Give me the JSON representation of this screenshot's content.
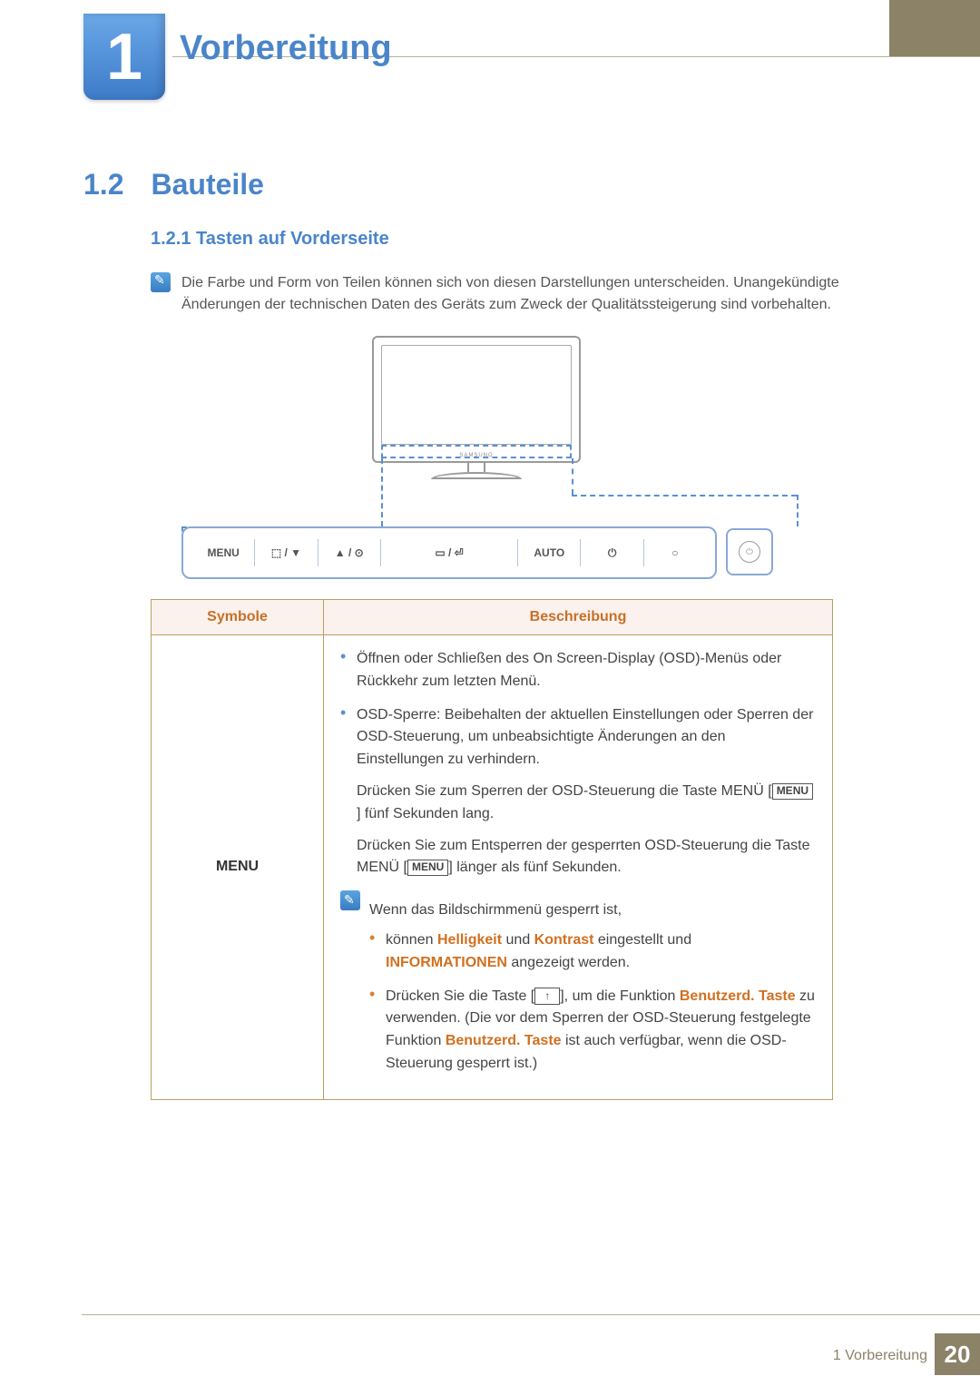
{
  "chapter": {
    "number": "1",
    "title": "Vorbereitung"
  },
  "section": {
    "number": "1.2",
    "title": "Bauteile"
  },
  "subsection": {
    "full": "1.2.1  Tasten auf Vorderseite"
  },
  "note1": "Die Farbe und Form von Teilen können sich von diesen Darstellungen unterscheiden. Unangekündigte Änderungen der technischen Daten des Geräts zum Zweck der Qualitätssteigerung sind vorbehalten.",
  "monitor_brand": "SAMSUNG",
  "panel": {
    "b1": "MENU",
    "b2": "⬚ / ▼",
    "b3": "▲ / ⊙",
    "b4": "▭ / ⏎",
    "b5": "AUTO",
    "b6": "⏻",
    "b7": "○",
    "extra": "⏻"
  },
  "table": {
    "h1": "Symbole",
    "h2": "Beschreibung",
    "row1_sym": "MENU",
    "r1_li1": "Öffnen oder Schließen des On Screen-Display (OSD)-Menüs oder Rückkehr zum letzten Menü.",
    "r1_li2": "OSD-Sperre: Beibehalten der aktuellen Einstellungen oder Sperren der OSD-Steuerung, um unbeabsichtigte Änderungen an den Einstellungen zu verhindern.",
    "r1_p1a": "Drücken Sie zum Sperren der OSD-Steuerung die Taste MENÜ [",
    "r1_p1_menu": "MENU",
    "r1_p1b": "] fünf Sekunden lang.",
    "r1_p2a": "Drücken Sie zum Entsperren der gesperrten OSD-Steuerung die Taste MENÜ [",
    "r1_p2_menu": "MENU",
    "r1_p2b": "] länger als fünf Sekunden.",
    "r1_note_intro": "Wenn das Bildschirmmenü gesperrt ist,",
    "r1_note_li1_a": "können ",
    "r1_note_li1_k1": "Helligkeit",
    "r1_note_li1_b": " und ",
    "r1_note_li1_k2": "Kontrast",
    "r1_note_li1_c": " eingestellt und ",
    "r1_note_li1_k3": "INFORMATIONEN",
    "r1_note_li1_d": " angezeigt werden.",
    "r1_note_li2_a": "Drücken Sie die Taste [",
    "r1_note_li2_arrow": "↑",
    "r1_note_li2_b": "], um die Funktion ",
    "r1_note_li2_k1": "Benutzerd. Taste",
    "r1_note_li2_c": " zu verwenden. (Die vor dem Sperren der OSD-Steuerung festgelegte Funktion ",
    "r1_note_li2_k2": "Benutzerd. Taste",
    "r1_note_li2_d": " ist auch verfügbar, wenn die OSD-Steuerung gesperrt ist.)"
  },
  "footer": {
    "text": "1 Vorbereitung",
    "page": "20"
  }
}
